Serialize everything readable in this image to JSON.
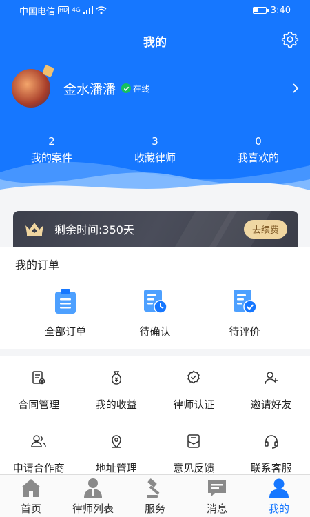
{
  "status_bar": {
    "carrier": "中国电信",
    "hd": "HD",
    "network": "4G",
    "time": "3:40",
    "battery_level": 0.35
  },
  "header": {
    "title": "我的"
  },
  "profile": {
    "name": "金水潘潘",
    "status": "在线"
  },
  "stats": [
    {
      "value": "2",
      "label": "我的案件"
    },
    {
      "value": "3",
      "label": "收藏律师"
    },
    {
      "value": "0",
      "label": "我喜欢的"
    }
  ],
  "membership": {
    "remaining_text": "剩余时间:350天",
    "renew_label": "去续费"
  },
  "orders": {
    "title": "我的订单",
    "items": [
      {
        "label": "全部订单",
        "icon": "clipboard-icon"
      },
      {
        "label": "待确认",
        "icon": "clock-document-icon"
      },
      {
        "label": "待评价",
        "icon": "check-document-icon"
      }
    ]
  },
  "services": [
    {
      "label": "合同管理",
      "icon": "contract-icon"
    },
    {
      "label": "我的收益",
      "icon": "money-bag-icon"
    },
    {
      "label": "律师认证",
      "icon": "badge-check-icon"
    },
    {
      "label": "邀请好友",
      "icon": "add-user-icon"
    },
    {
      "label": "申请合作商",
      "icon": "partner-icon"
    },
    {
      "label": "地址管理",
      "icon": "location-icon"
    },
    {
      "label": "意见反馈",
      "icon": "feedback-icon"
    },
    {
      "label": "联系客服",
      "icon": "headset-icon"
    }
  ],
  "tabbar": [
    {
      "label": "首页",
      "icon": "home-icon"
    },
    {
      "label": "律师列表",
      "icon": "lawyer-icon"
    },
    {
      "label": "服务",
      "icon": "gavel-icon"
    },
    {
      "label": "消息",
      "icon": "message-icon"
    },
    {
      "label": "我的",
      "icon": "person-icon",
      "active": true
    }
  ],
  "colors": {
    "primary": "#1677ff",
    "vip_dark": "#3c3f4b",
    "vip_gold": "#f0d6a0",
    "online_green": "#16c060"
  }
}
